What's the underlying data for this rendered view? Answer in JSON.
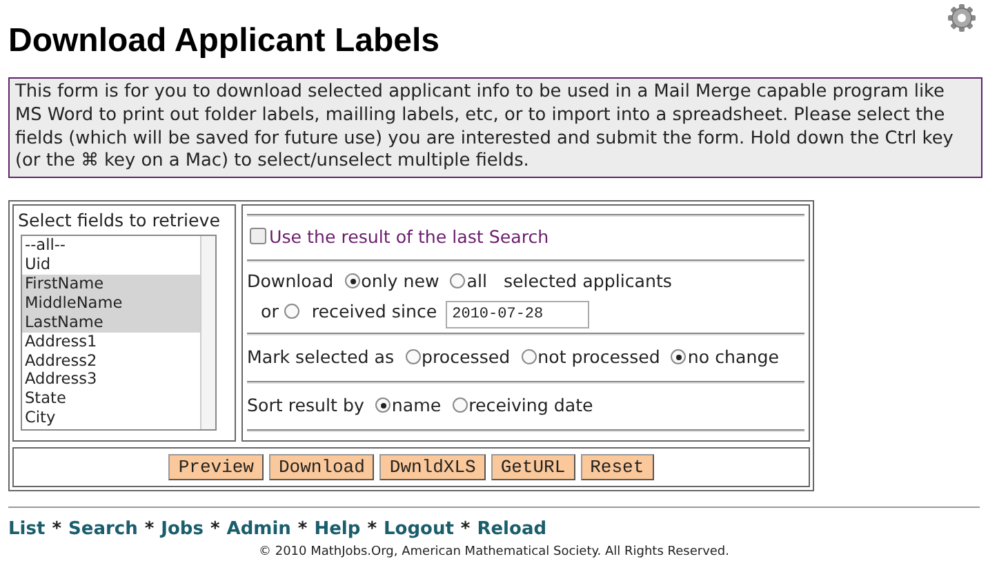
{
  "title": "Download Applicant Labels",
  "info": "This form is for you to download selected applicant info to be used in a Mail Merge capable program like MS Word to print out folder labels, mailling labels, etc, or to import into a spreadsheet. Please select the fields (which will be saved for future use) you are interested and submit the form. Hold down the Ctrl key (or the ⌘ key on a Mac) to select/unselect multiple fields.",
  "fields": {
    "label": "Select fields to retrieve",
    "options": [
      {
        "label": "--all--",
        "selected": false
      },
      {
        "label": "Uid",
        "selected": false
      },
      {
        "label": "FirstName",
        "selected": true
      },
      {
        "label": "MiddleName",
        "selected": true
      },
      {
        "label": "LastName",
        "selected": true
      },
      {
        "label": "Address1",
        "selected": false
      },
      {
        "label": "Address2",
        "selected": false
      },
      {
        "label": "Address3",
        "selected": false
      },
      {
        "label": "State",
        "selected": false
      },
      {
        "label": "City",
        "selected": false
      }
    ]
  },
  "use_last_search": {
    "label": "Use the result of the last Search",
    "checked": false
  },
  "download": {
    "label": "Download",
    "options": [
      {
        "label": "only new",
        "selected": true
      },
      {
        "label": "all",
        "selected": false
      }
    ],
    "suffix": "selected applicants",
    "or_label": "or",
    "since": {
      "label": "received since",
      "selected": false,
      "value": "2010-07-28"
    }
  },
  "mark": {
    "label": "Mark selected as",
    "options": [
      {
        "label": "processed",
        "selected": false
      },
      {
        "label": "not processed",
        "selected": false
      },
      {
        "label": "no change",
        "selected": true
      }
    ]
  },
  "sort": {
    "label": "Sort result by",
    "options": [
      {
        "label": "name",
        "selected": true
      },
      {
        "label": "receiving date",
        "selected": false
      }
    ]
  },
  "buttons": [
    "Preview",
    "Download",
    "DwnldXLS",
    "GetURL",
    "Reset"
  ],
  "footer_links": [
    "List",
    "Search",
    "Jobs",
    "Admin",
    "Help",
    "Logout",
    "Reload"
  ],
  "footer_separator": "*",
  "copyright": "© 2010 MathJobs.Org, American Mathematical Society. All Rights Reserved."
}
